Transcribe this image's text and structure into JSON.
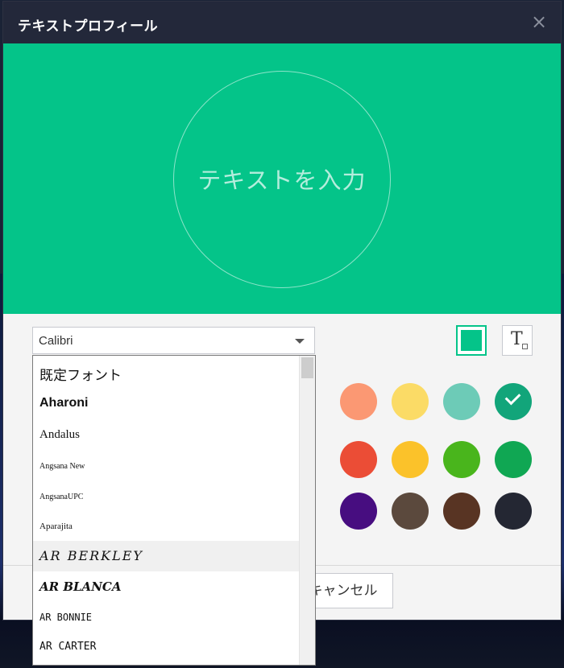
{
  "dialog": {
    "title": "テキストプロフィール",
    "close_symbol": "×"
  },
  "preview": {
    "placeholder": "テキストを入力",
    "background_color": "#04c489"
  },
  "font_select": {
    "value": "Calibri"
  },
  "font_list": {
    "options": [
      "既定フォント",
      "Aharoni",
      "Andalus",
      "Angsana New",
      "AngsanaUPC",
      "Aparajita",
      "AR BERKLEY",
      "AR BLANCA",
      "AR BONNIE",
      "AR CARTER"
    ],
    "hovered": "AR BERKLEY"
  },
  "colors": {
    "row1": [
      "#ff7a7a",
      "#fb9873",
      "#fbdb66",
      "#6dcbb7",
      "#12a57a"
    ],
    "row2": [
      "#f58040",
      "#eb4d36",
      "#fbc22a",
      "#49b51c",
      "#10a753"
    ],
    "row3": [
      "#7e1fb2",
      "#470d80",
      "#5b493d",
      "#583423",
      "#242733"
    ],
    "selected": "#12a57a"
  },
  "footer": {
    "cancel_label": "キャンセル"
  }
}
